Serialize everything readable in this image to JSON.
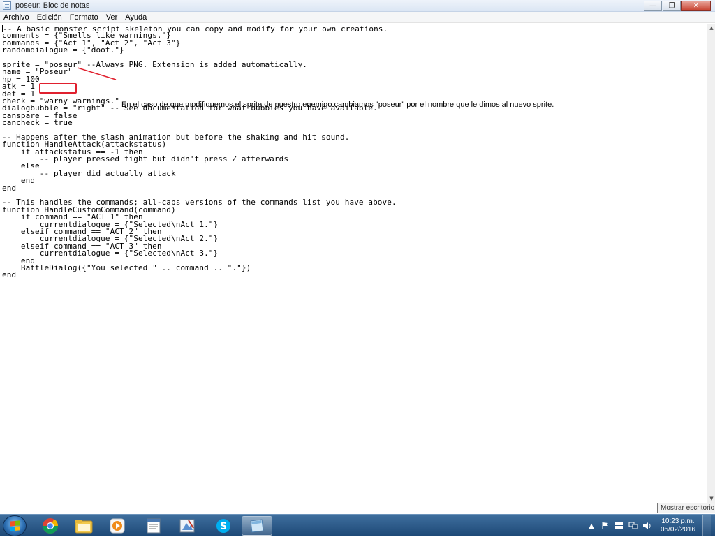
{
  "window": {
    "title": "poseur: Bloc de notas",
    "minimize_symbol": "—",
    "maximize_symbol": "❐",
    "close_symbol": "✕"
  },
  "menu": {
    "items": [
      "Archivo",
      "Edición",
      "Formato",
      "Ver",
      "Ayuda"
    ]
  },
  "editor": {
    "lines": [
      "-- A basic monster script skeleton you can copy and modify for your own creations.",
      "comments = {\"Smells like warnings.\"}",
      "commands = {\"Act 1\", \"Act 2\", \"Act 3\"}",
      "randomdialogue = {\"doot.\"}",
      "",
      "sprite = \"poseur\" --Always PNG. Extension is added automatically.",
      "name = \"Poseur\"",
      "hp = 100",
      "atk = 1",
      "def = 1",
      "check = \"warny warnings.\"",
      "dialogbubble = \"right\" -- See documentation for what bubbles you have available.",
      "canspare = false",
      "cancheck = true",
      "",
      "-- Happens after the slash animation but before the shaking and hit sound.",
      "function HandleAttack(attackstatus)",
      "    if attackstatus == -1 then",
      "        -- player pressed fight but didn't press Z afterwards",
      "    else",
      "        -- player did actually attack",
      "    end",
      "end",
      "",
      "-- This handles the commands; all-caps versions of the commands list you have above.",
      "function HandleCustomCommand(command)",
      "    if command == \"ACT 1\" then",
      "        currentdialogue = {\"Selected\\nAct 1.\"}",
      "    elseif command == \"ACT 2\" then",
      "        currentdialogue = {\"Selected\\nAct 2.\"}",
      "    elseif command == \"ACT 3\" then",
      "        currentdialogue = {\"Selected\\nAct 3.\"}",
      "    end",
      "    BattleDialog({\"You selected \" .. command .. \".\"})",
      "end"
    ]
  },
  "annotation": {
    "text": "En el caso de que modifiquemos el sprite de nuestro enemigo cambiamos \"poseur\" por el nombre que le dimos al nuevo sprite.",
    "color": "#e0202e"
  },
  "tooltip": {
    "text": "Mostrar escritorio"
  },
  "taskbar": {
    "apps": [
      "chrome-icon",
      "file-explorer-icon",
      "media-player-icon",
      "notepad-doc-icon",
      "paint-icon",
      "skype-icon",
      "notepad-icon"
    ],
    "tray": {
      "time": "10:23 p.m.",
      "date": "05/02/2016",
      "expand_symbol": "▲"
    }
  },
  "colors": {
    "taskbar": "#2a5686",
    "accent": "#e0202e",
    "close_button": "#c7412f"
  }
}
